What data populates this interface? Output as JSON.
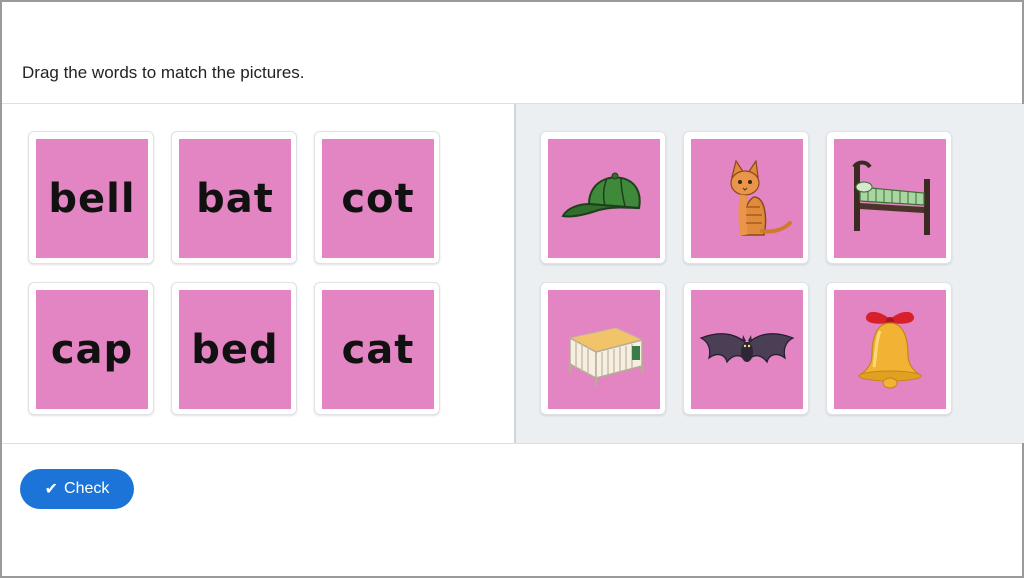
{
  "instruction": "Drag the words to match the pictures.",
  "colors": {
    "card_fill": "#e384c3",
    "button": "#1d74d8",
    "pictures_panel": "#eceff2"
  },
  "words": [
    {
      "label": "bell"
    },
    {
      "label": "bat"
    },
    {
      "label": "cot"
    },
    {
      "label": "cap"
    },
    {
      "label": "bed"
    },
    {
      "label": "cat"
    }
  ],
  "pictures": [
    {
      "icon": "cap-icon"
    },
    {
      "icon": "cat-icon"
    },
    {
      "icon": "bed-icon"
    },
    {
      "icon": "cot-icon"
    },
    {
      "icon": "bat-icon"
    },
    {
      "icon": "bell-icon"
    }
  ],
  "check_button": {
    "label": "Check",
    "icon": "check-icon"
  }
}
